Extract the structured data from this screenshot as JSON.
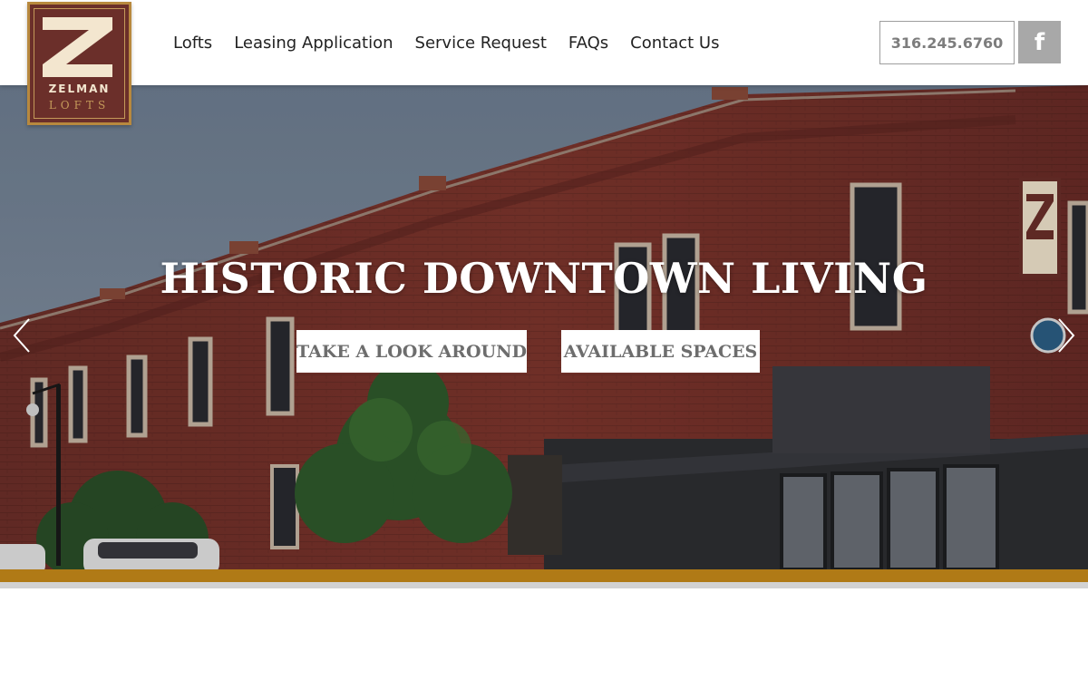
{
  "brand": {
    "logo_letter": "Z",
    "name": "ZELMAN",
    "sub": "LOFTS"
  },
  "nav": {
    "items": [
      {
        "label": "Lofts"
      },
      {
        "label": "Leasing Application"
      },
      {
        "label": "Service Request"
      },
      {
        "label": "FAQs"
      },
      {
        "label": "Contact Us"
      }
    ]
  },
  "header_actions": {
    "phone": "316.245.6760",
    "facebook_icon": "f"
  },
  "hero": {
    "title": "HISTORIC DOWNTOWN LIVING",
    "buttons": {
      "look": "TAKE A LOOK AROUND",
      "spaces": "AVAILABLE SPACES"
    },
    "prev_icon": "chevron-left-icon",
    "next_icon": "chevron-right-icon"
  },
  "colors": {
    "brand_maroon": "#6b2f2a",
    "brand_gold": "#b07a16",
    "sky": "#7d8c9f",
    "brick": "#8a3b30"
  }
}
